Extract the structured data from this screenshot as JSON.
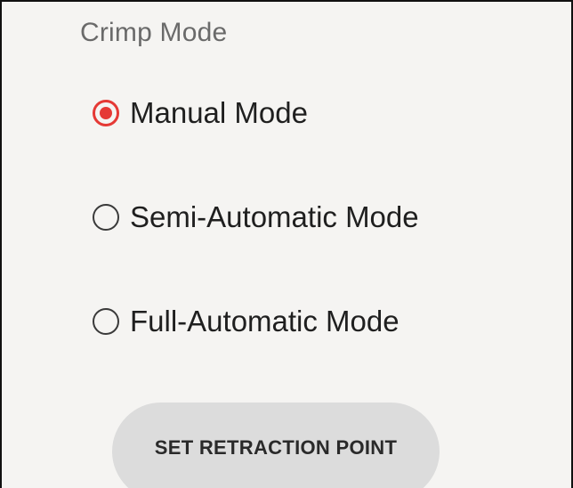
{
  "crimp_mode": {
    "title": "Crimp Mode",
    "accent_color": "#e53935",
    "options": [
      {
        "label": "Manual Mode",
        "selected": true
      },
      {
        "label": "Semi-Automatic Mode",
        "selected": false
      },
      {
        "label": "Full-Automatic Mode",
        "selected": false
      }
    ]
  },
  "actions": {
    "set_retraction_point_label": "SET RETRACTION POINT"
  }
}
